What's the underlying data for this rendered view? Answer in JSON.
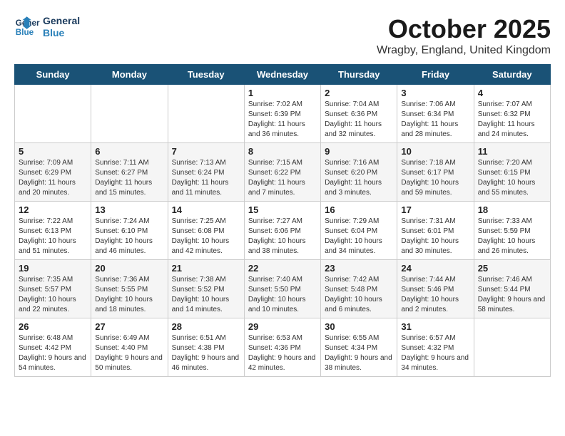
{
  "header": {
    "logo_line1": "General",
    "logo_line2": "Blue",
    "month": "October 2025",
    "location": "Wragby, England, United Kingdom"
  },
  "weekdays": [
    "Sunday",
    "Monday",
    "Tuesday",
    "Wednesday",
    "Thursday",
    "Friday",
    "Saturday"
  ],
  "weeks": [
    [
      {
        "day": "",
        "info": ""
      },
      {
        "day": "",
        "info": ""
      },
      {
        "day": "",
        "info": ""
      },
      {
        "day": "1",
        "info": "Sunrise: 7:02 AM\nSunset: 6:39 PM\nDaylight: 11 hours and 36 minutes."
      },
      {
        "day": "2",
        "info": "Sunrise: 7:04 AM\nSunset: 6:36 PM\nDaylight: 11 hours and 32 minutes."
      },
      {
        "day": "3",
        "info": "Sunrise: 7:06 AM\nSunset: 6:34 PM\nDaylight: 11 hours and 28 minutes."
      },
      {
        "day": "4",
        "info": "Sunrise: 7:07 AM\nSunset: 6:32 PM\nDaylight: 11 hours and 24 minutes."
      }
    ],
    [
      {
        "day": "5",
        "info": "Sunrise: 7:09 AM\nSunset: 6:29 PM\nDaylight: 11 hours and 20 minutes."
      },
      {
        "day": "6",
        "info": "Sunrise: 7:11 AM\nSunset: 6:27 PM\nDaylight: 11 hours and 15 minutes."
      },
      {
        "day": "7",
        "info": "Sunrise: 7:13 AM\nSunset: 6:24 PM\nDaylight: 11 hours and 11 minutes."
      },
      {
        "day": "8",
        "info": "Sunrise: 7:15 AM\nSunset: 6:22 PM\nDaylight: 11 hours and 7 minutes."
      },
      {
        "day": "9",
        "info": "Sunrise: 7:16 AM\nSunset: 6:20 PM\nDaylight: 11 hours and 3 minutes."
      },
      {
        "day": "10",
        "info": "Sunrise: 7:18 AM\nSunset: 6:17 PM\nDaylight: 10 hours and 59 minutes."
      },
      {
        "day": "11",
        "info": "Sunrise: 7:20 AM\nSunset: 6:15 PM\nDaylight: 10 hours and 55 minutes."
      }
    ],
    [
      {
        "day": "12",
        "info": "Sunrise: 7:22 AM\nSunset: 6:13 PM\nDaylight: 10 hours and 51 minutes."
      },
      {
        "day": "13",
        "info": "Sunrise: 7:24 AM\nSunset: 6:10 PM\nDaylight: 10 hours and 46 minutes."
      },
      {
        "day": "14",
        "info": "Sunrise: 7:25 AM\nSunset: 6:08 PM\nDaylight: 10 hours and 42 minutes."
      },
      {
        "day": "15",
        "info": "Sunrise: 7:27 AM\nSunset: 6:06 PM\nDaylight: 10 hours and 38 minutes."
      },
      {
        "day": "16",
        "info": "Sunrise: 7:29 AM\nSunset: 6:04 PM\nDaylight: 10 hours and 34 minutes."
      },
      {
        "day": "17",
        "info": "Sunrise: 7:31 AM\nSunset: 6:01 PM\nDaylight: 10 hours and 30 minutes."
      },
      {
        "day": "18",
        "info": "Sunrise: 7:33 AM\nSunset: 5:59 PM\nDaylight: 10 hours and 26 minutes."
      }
    ],
    [
      {
        "day": "19",
        "info": "Sunrise: 7:35 AM\nSunset: 5:57 PM\nDaylight: 10 hours and 22 minutes."
      },
      {
        "day": "20",
        "info": "Sunrise: 7:36 AM\nSunset: 5:55 PM\nDaylight: 10 hours and 18 minutes."
      },
      {
        "day": "21",
        "info": "Sunrise: 7:38 AM\nSunset: 5:52 PM\nDaylight: 10 hours and 14 minutes."
      },
      {
        "day": "22",
        "info": "Sunrise: 7:40 AM\nSunset: 5:50 PM\nDaylight: 10 hours and 10 minutes."
      },
      {
        "day": "23",
        "info": "Sunrise: 7:42 AM\nSunset: 5:48 PM\nDaylight: 10 hours and 6 minutes."
      },
      {
        "day": "24",
        "info": "Sunrise: 7:44 AM\nSunset: 5:46 PM\nDaylight: 10 hours and 2 minutes."
      },
      {
        "day": "25",
        "info": "Sunrise: 7:46 AM\nSunset: 5:44 PM\nDaylight: 9 hours and 58 minutes."
      }
    ],
    [
      {
        "day": "26",
        "info": "Sunrise: 6:48 AM\nSunset: 4:42 PM\nDaylight: 9 hours and 54 minutes."
      },
      {
        "day": "27",
        "info": "Sunrise: 6:49 AM\nSunset: 4:40 PM\nDaylight: 9 hours and 50 minutes."
      },
      {
        "day": "28",
        "info": "Sunrise: 6:51 AM\nSunset: 4:38 PM\nDaylight: 9 hours and 46 minutes."
      },
      {
        "day": "29",
        "info": "Sunrise: 6:53 AM\nSunset: 4:36 PM\nDaylight: 9 hours and 42 minutes."
      },
      {
        "day": "30",
        "info": "Sunrise: 6:55 AM\nSunset: 4:34 PM\nDaylight: 9 hours and 38 minutes."
      },
      {
        "day": "31",
        "info": "Sunrise: 6:57 AM\nSunset: 4:32 PM\nDaylight: 9 hours and 34 minutes."
      },
      {
        "day": "",
        "info": ""
      }
    ]
  ]
}
